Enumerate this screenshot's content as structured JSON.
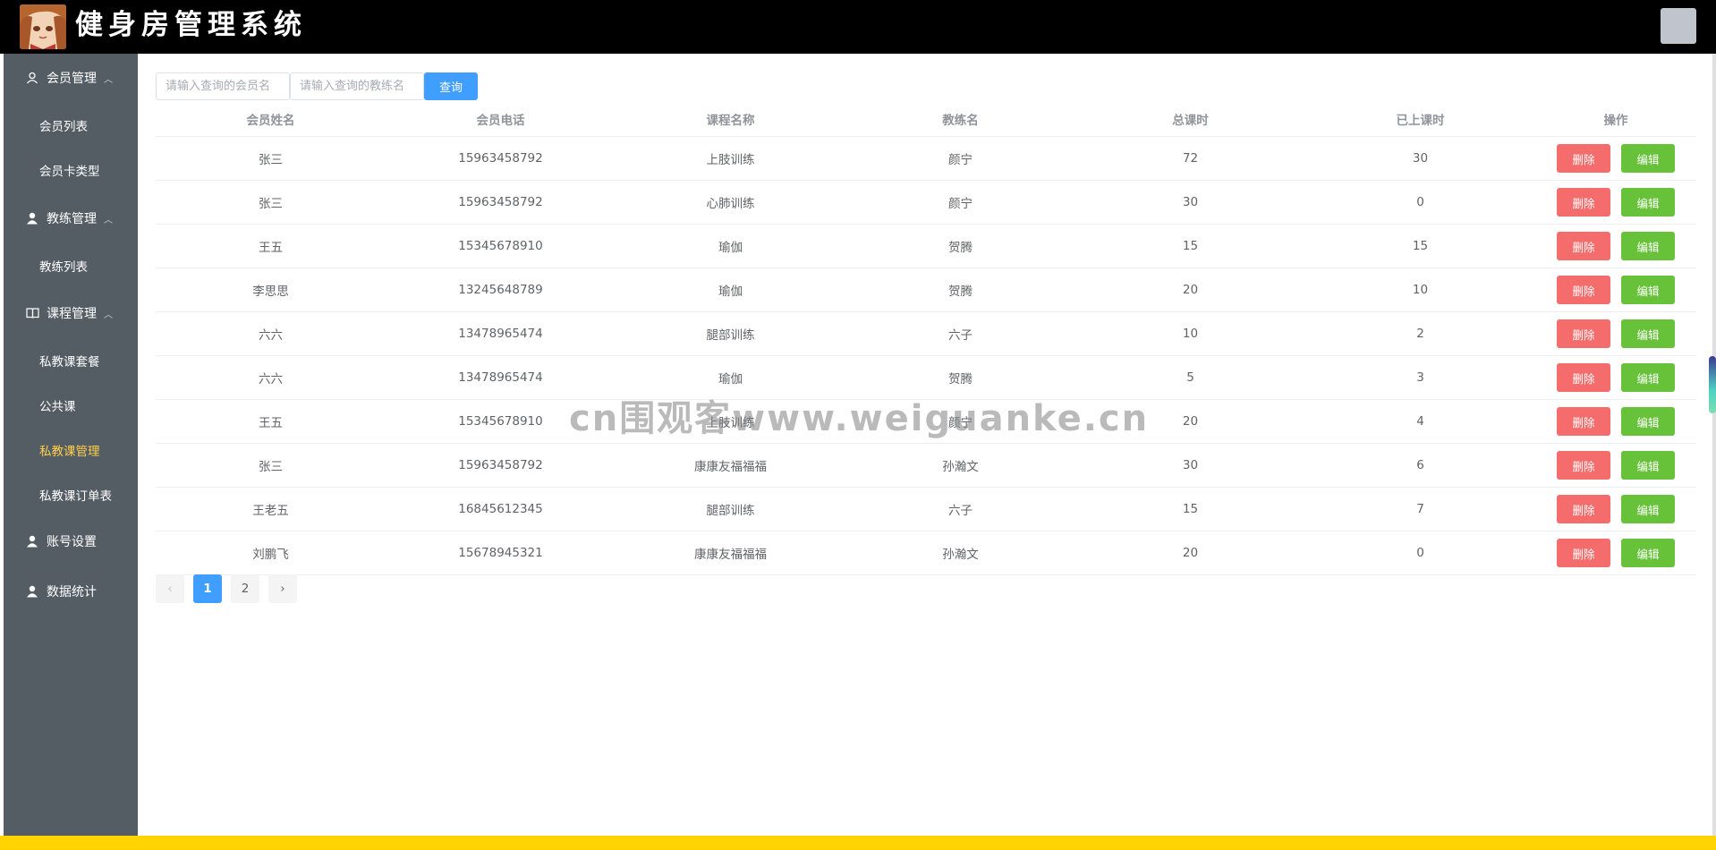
{
  "header": {
    "title": "健身房管理系统"
  },
  "sidebar": {
    "groups": [
      {
        "label": "会员管理",
        "icon": "user-outline-icon",
        "items": [
          "会员列表",
          "会员卡类型"
        ]
      },
      {
        "label": "教练管理",
        "icon": "user-solid-icon",
        "items": [
          "教练列表"
        ]
      },
      {
        "label": "课程管理",
        "icon": "book-icon",
        "items": [
          "私教课套餐",
          "公共课",
          "私教课管理",
          "私教课订单表"
        ]
      },
      {
        "label": "账号设置",
        "icon": "user-solid-icon",
        "items": []
      },
      {
        "label": "数据统计",
        "icon": "user-solid-icon",
        "items": []
      }
    ],
    "active_item": "私教课管理"
  },
  "search": {
    "member_placeholder": "请输入查询的会员名",
    "coach_placeholder": "请输入查询的教练名",
    "button_label": "查询"
  },
  "table": {
    "columns": [
      "会员姓名",
      "会员电话",
      "课程名称",
      "教练名",
      "总课时",
      "已上课时",
      "操作"
    ],
    "rows": [
      {
        "name": "张三",
        "phone": "15963458792",
        "course": "上肢训练",
        "coach": "颜宁",
        "total": "72",
        "done": "30"
      },
      {
        "name": "张三",
        "phone": "15963458792",
        "course": "心肺训练",
        "coach": "颜宁",
        "total": "30",
        "done": "0"
      },
      {
        "name": "王五",
        "phone": "15345678910",
        "course": "瑜伽",
        "coach": "贺腾",
        "total": "15",
        "done": "15"
      },
      {
        "name": "李思思",
        "phone": "13245648789",
        "course": "瑜伽",
        "coach": "贺腾",
        "total": "20",
        "done": "10"
      },
      {
        "name": "六六",
        "phone": "13478965474",
        "course": "腿部训练",
        "coach": "六子",
        "total": "10",
        "done": "2"
      },
      {
        "name": "六六",
        "phone": "13478965474",
        "course": "瑜伽",
        "coach": "贺腾",
        "total": "5",
        "done": "3"
      },
      {
        "name": "王五",
        "phone": "15345678910",
        "course": "上肢训练",
        "coach": "颜宁",
        "total": "20",
        "done": "4"
      },
      {
        "name": "张三",
        "phone": "15963458792",
        "course": "康康友福福福",
        "coach": "孙瀚文",
        "total": "30",
        "done": "6"
      },
      {
        "name": "王老五",
        "phone": "16845612345",
        "course": "腿部训练",
        "coach": "六子",
        "total": "15",
        "done": "7"
      },
      {
        "name": "刘鹏飞",
        "phone": "15678945321",
        "course": "康康友福福福",
        "coach": "孙瀚文",
        "total": "20",
        "done": "0"
      }
    ],
    "delete_label": "删除",
    "edit_label": "编辑"
  },
  "pagination": {
    "prev": "‹",
    "pages": [
      "1",
      "2"
    ],
    "current": "1",
    "next": "›"
  },
  "watermark": "cn围观客www.weiguanke.cn",
  "colors": {
    "header_bg": "#000000",
    "sidebar_bg": "#545c64",
    "active_menu": "#ffd04b",
    "primary": "#409eff",
    "danger": "#f56c6c",
    "success": "#67c23a",
    "bottom_strip": "#ffd400"
  }
}
